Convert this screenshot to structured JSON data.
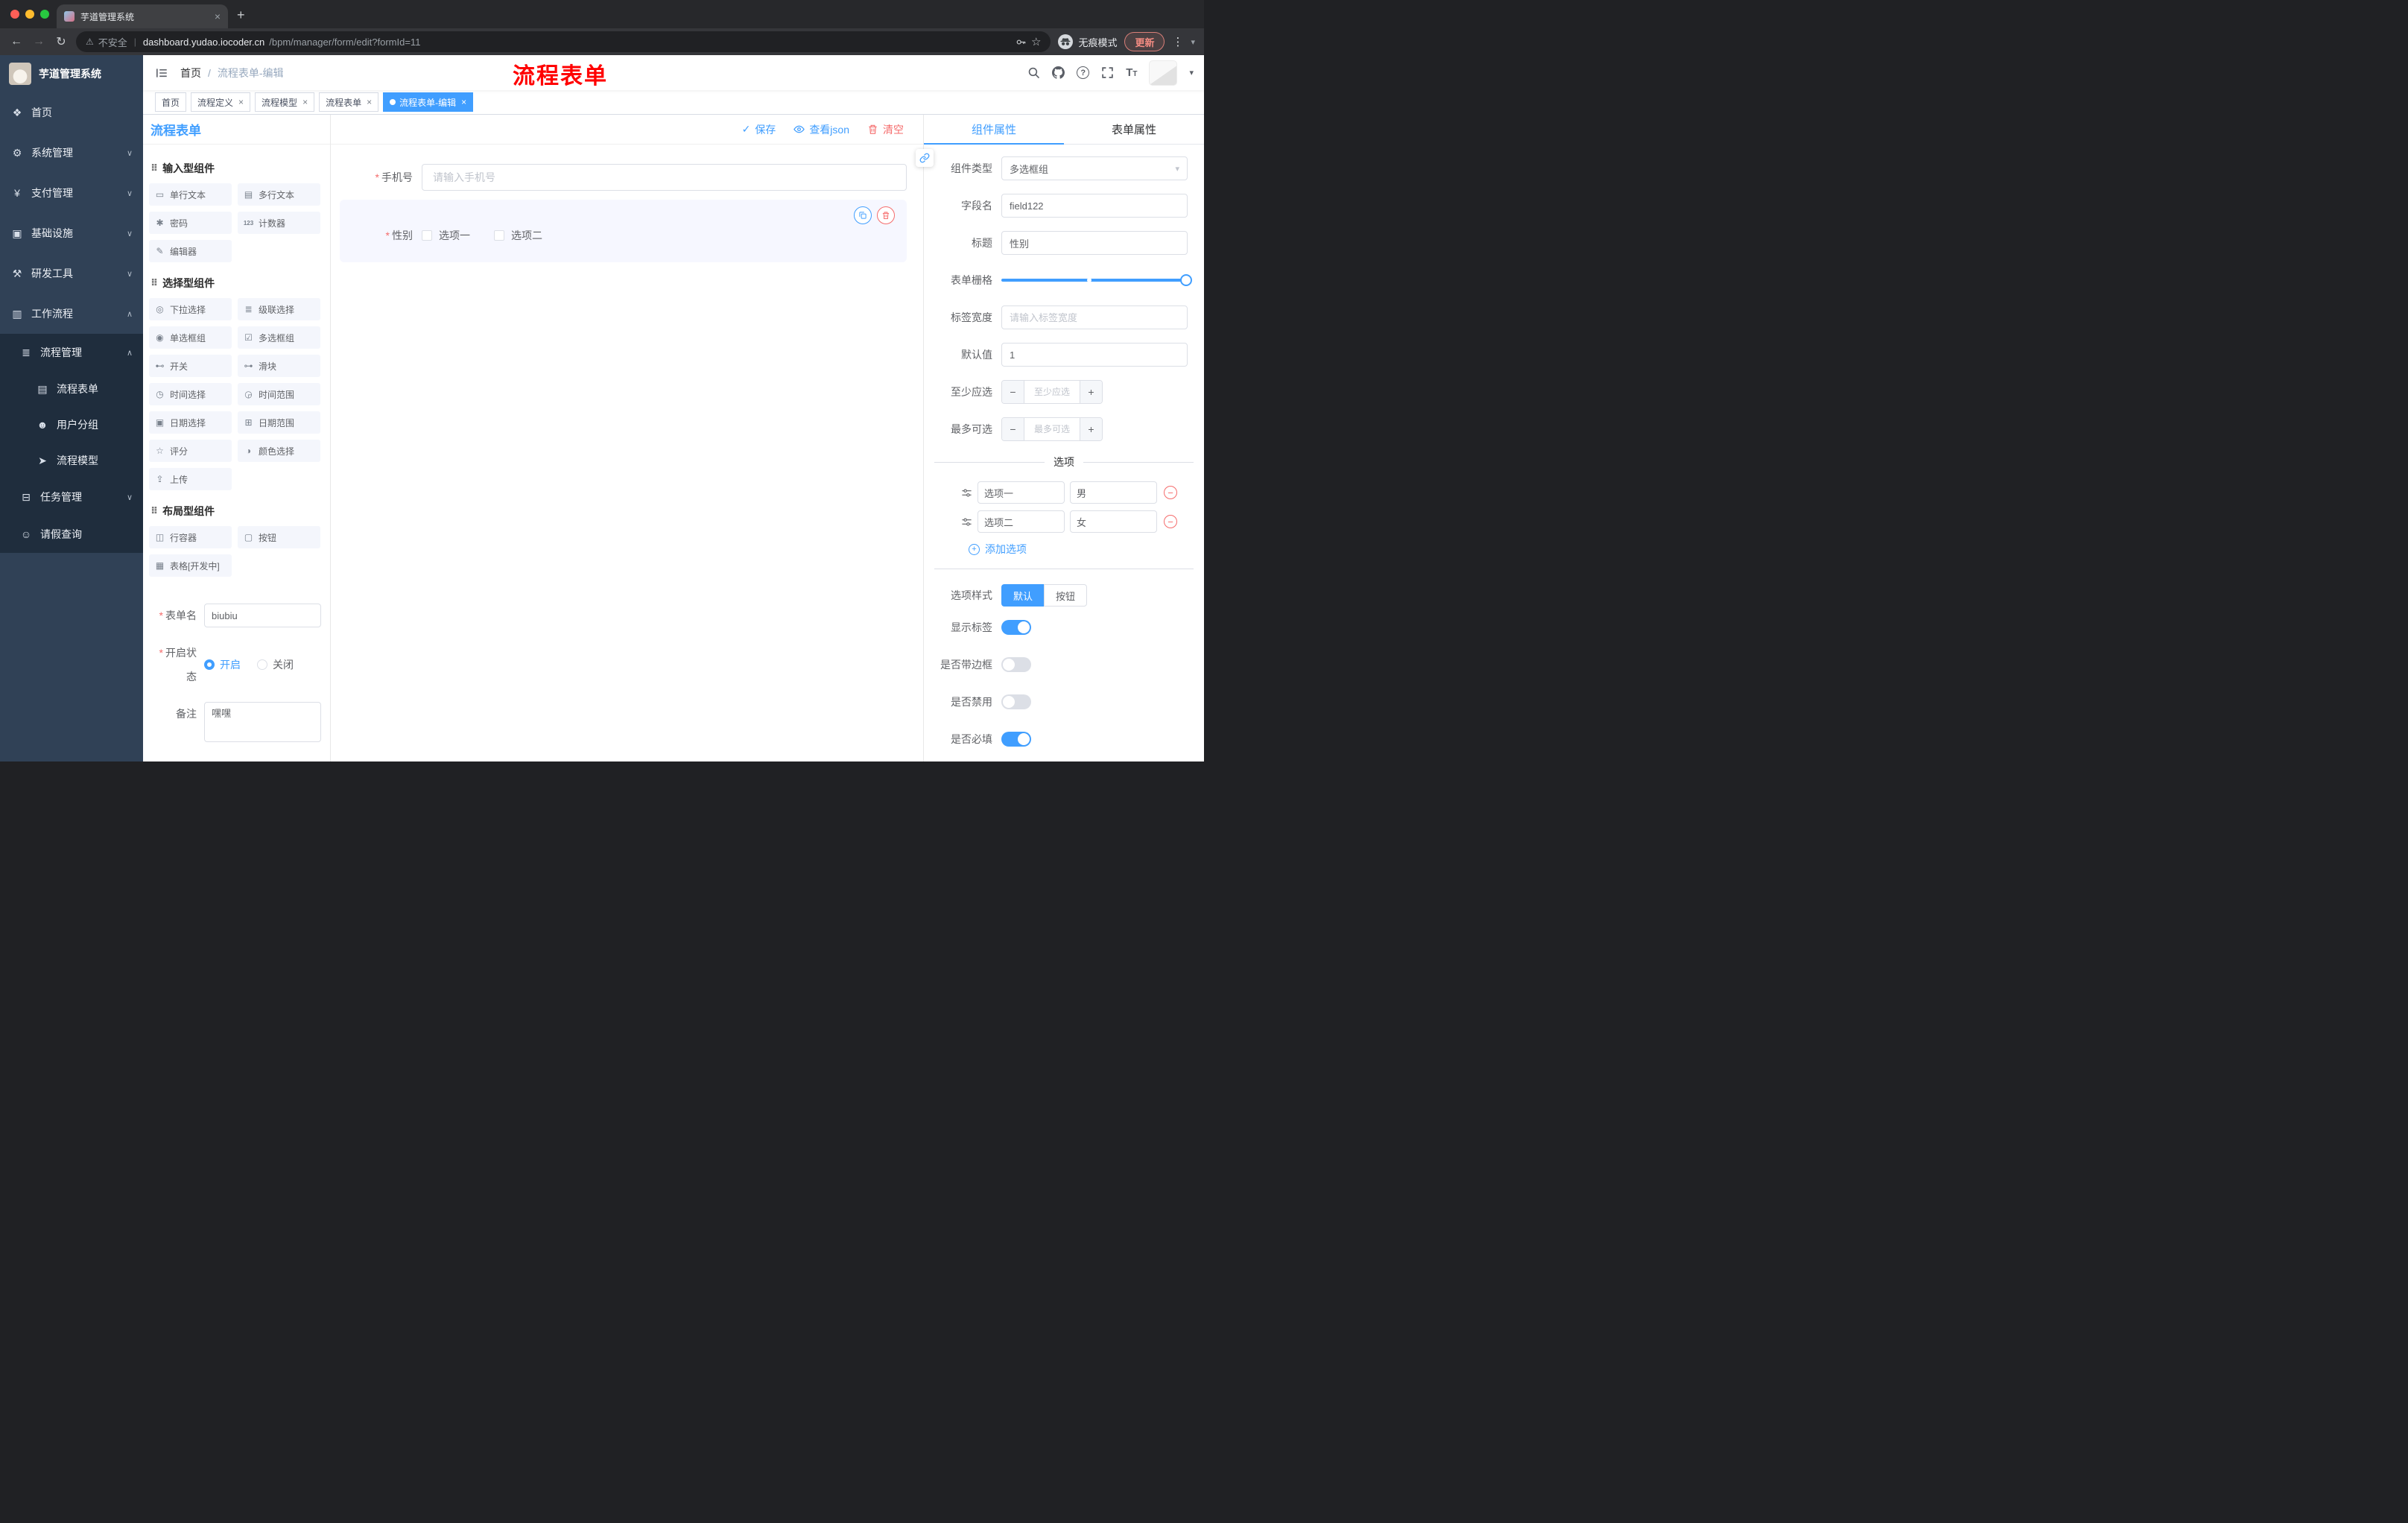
{
  "colors": {
    "primary": "#409eff",
    "danger": "#f56c6c"
  },
  "glyphs": {
    "required": "*",
    "check": "✓",
    "close": "×",
    "plus": "+",
    "minus": "−",
    "back": "←",
    "forward": "→",
    "reload": "↻",
    "warning": "⚠",
    "pipe": "|",
    "star": "☆",
    "dots": "⋮",
    "caret": "▾",
    "slash": "/",
    "question": "?",
    "t_large": "T",
    "t_small": "T",
    "drag": "⠿",
    "chevron_down": "∨",
    "chevron_up": "∧"
  },
  "browser": {
    "tab_title": "芋道管理系统",
    "security_label": "不安全",
    "url_host": "dashboard.yudao.iocoder.cn",
    "url_path": "/bpm/manager/form/edit?formId=11",
    "incognito_label": "无痕模式",
    "update_label": "更新"
  },
  "sidebar": {
    "brand": "芋道管理系统",
    "menu": [
      {
        "label": "首页",
        "icon": "❖"
      },
      {
        "label": "系统管理",
        "icon": "⚙"
      },
      {
        "label": "支付管理",
        "icon": "¥"
      },
      {
        "label": "基础设施",
        "icon": "▣"
      },
      {
        "label": "研发工具",
        "icon": "⚒"
      },
      {
        "label": "工作流程",
        "icon": "▥"
      }
    ],
    "workflow": {
      "group_label": "流程管理",
      "group_icon": "≣",
      "children": [
        {
          "label": "流程表单",
          "icon": "▤"
        },
        {
          "label": "用户分组",
          "icon": "☻"
        },
        {
          "label": "流程模型",
          "icon": "➤"
        }
      ],
      "task_label": "任务管理",
      "task_icon": "⊟",
      "leave_label": "请假查询",
      "leave_icon": "☺"
    }
  },
  "header": {
    "breadcrumb_home": "首页",
    "breadcrumb_current": "流程表单-编辑",
    "annotation": "流程表单"
  },
  "tags": [
    {
      "label": "首页"
    },
    {
      "label": "流程定义"
    },
    {
      "label": "流程模型"
    },
    {
      "label": "流程表单"
    },
    {
      "label": "流程表单-编辑"
    }
  ],
  "palette": {
    "title": "流程表单",
    "sections": [
      {
        "title": "输入型组件",
        "items": [
          {
            "label": "单行文本",
            "icon": "▭"
          },
          {
            "label": "多行文本",
            "icon": "▤"
          },
          {
            "label": "密码",
            "icon": "✱"
          },
          {
            "label": "计数器",
            "icon": "123"
          },
          {
            "label": "编辑器",
            "icon": "✎"
          }
        ]
      },
      {
        "title": "选择型组件",
        "items": [
          {
            "label": "下拉选择",
            "icon": "◎"
          },
          {
            "label": "级联选择",
            "icon": "≣"
          },
          {
            "label": "单选框组",
            "icon": "◉"
          },
          {
            "label": "多选框组",
            "icon": "☑"
          },
          {
            "label": "开关",
            "icon": "⊷"
          },
          {
            "label": "滑块",
            "icon": "⊶"
          },
          {
            "label": "时间选择",
            "icon": "◷"
          },
          {
            "label": "时间范围",
            "icon": "◶"
          },
          {
            "label": "日期选择",
            "icon": "▣"
          },
          {
            "label": "日期范围",
            "icon": "⊞"
          },
          {
            "label": "评分",
            "icon": "☆"
          },
          {
            "label": "颜色选择",
            "icon": "◑"
          },
          {
            "label": "上传",
            "icon": "⇪"
          }
        ]
      },
      {
        "title": "布局型组件",
        "items": [
          {
            "label": "行容器",
            "icon": "◫"
          },
          {
            "label": "按钮",
            "icon": "▢"
          },
          {
            "label": "表格[开发中]",
            "icon": "▦"
          }
        ]
      }
    ],
    "form": {
      "name_label": "表单名",
      "name_value": "biubiu",
      "status_label": "开启状态",
      "status_on": "开启",
      "status_off": "关闭",
      "remark_label": "备注",
      "remark_value": "嘿嘿"
    }
  },
  "canvas": {
    "actions": {
      "save": "保存",
      "view_json": "查看json",
      "clear": "清空"
    },
    "fields": [
      {
        "label": "手机号",
        "plac": "请输入手机号"
      },
      {
        "label": "性别",
        "options": [
          "选项一",
          "选项二"
        ]
      }
    ]
  },
  "props": {
    "tabs": {
      "component": "组件属性",
      "form": "表单属性"
    },
    "component_type_label": "组件类型",
    "component_type_value": "多选框组",
    "field_name_label": "字段名",
    "field_name_value": "field122",
    "title_label": "标题",
    "title_value": "性别",
    "grid_label": "表单栅格",
    "label_width_label": "标签宽度",
    "label_width_placeholder": "请输入标签宽度",
    "default_label": "默认值",
    "default_value": "1",
    "min_select_label": "至少应选",
    "min_select_placeholder": "至少应选",
    "max_select_label": "最多可选",
    "max_select_placeholder": "最多可选",
    "options_divider": "选项",
    "options": [
      {
        "name": "选项一",
        "value": "男"
      },
      {
        "name": "选项二",
        "value": "女"
      }
    ],
    "add_option": "添加选项",
    "option_style_label": "选项样式",
    "style_default": "默认",
    "style_button": "按钮",
    "switches": [
      {
        "label": "显示标签",
        "on": true
      },
      {
        "label": "是否带边框",
        "on": false
      },
      {
        "label": "是否禁用",
        "on": false
      },
      {
        "label": "是否必填",
        "on": true
      }
    ]
  }
}
